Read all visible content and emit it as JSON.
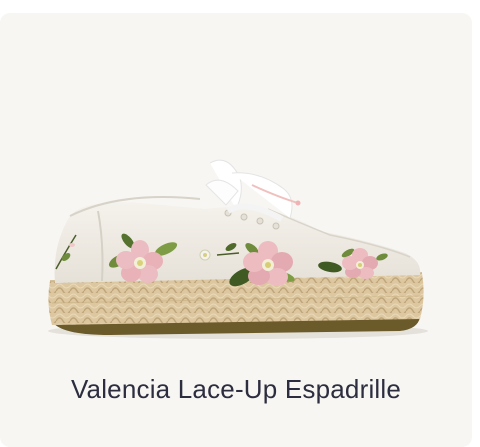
{
  "product": {
    "name": "Valencia Lace-Up Espadrille",
    "image_subject": "white canvas platform espadrille sneaker with embroidered pink flowers and white ribbon laces",
    "colors": {
      "card_background": "#f7f6f3",
      "title_text": "#2c2d3f",
      "canvas": "#efece6",
      "jute": "#dcc7a0",
      "flower_pink": "#e9b7bd",
      "leaf_green": "#5f7c3a",
      "sole": "#6b5a2a"
    }
  }
}
